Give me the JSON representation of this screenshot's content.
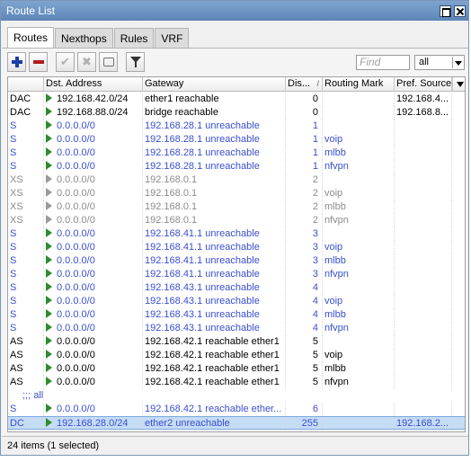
{
  "window": {
    "title": "Route List"
  },
  "tabs": [
    {
      "label": "Routes",
      "active": true
    },
    {
      "label": "Nexthops",
      "active": false
    },
    {
      "label": "Rules",
      "active": false
    },
    {
      "label": "VRF",
      "active": false
    }
  ],
  "toolbar": {
    "buttons": [
      "add-icon",
      "remove-icon",
      "enable-icon",
      "disable-icon",
      "comment-icon",
      "filter-icon"
    ],
    "find_placeholder": "Find",
    "scope_value": "all"
  },
  "columns": [
    "",
    "Dst. Address",
    "Gateway",
    "Dis...",
    "Routing Mark",
    "Pref. Source"
  ],
  "colors": {
    "unreachable": "#3a4fcf",
    "inactive": "#8c8c8c",
    "active_arrow": "#2e8b2e",
    "selected": "#c5dcf5"
  },
  "rows": [
    {
      "flags": "DAC",
      "dst": "192.168.42.0/24",
      "gateway": "ether1 reachable",
      "distance": "0",
      "mark": "",
      "pref": "192.168.4...",
      "state": "reach"
    },
    {
      "flags": "DAC",
      "dst": "192.168.88.0/24",
      "gateway": "bridge reachable",
      "distance": "0",
      "mark": "",
      "pref": "192.168.8...",
      "state": "reach"
    },
    {
      "flags": "S",
      "dst": "0.0.0.0/0",
      "gateway": "192.168.28.1 unreachable",
      "distance": "1",
      "mark": "",
      "pref": "",
      "state": "unreach"
    },
    {
      "flags": "S",
      "dst": "0.0.0.0/0",
      "gateway": "192.168.28.1 unreachable",
      "distance": "1",
      "mark": "voip",
      "pref": "",
      "state": "unreach"
    },
    {
      "flags": "S",
      "dst": "0.0.0.0/0",
      "gateway": "192.168.28.1 unreachable",
      "distance": "1",
      "mark": "mlbb",
      "pref": "",
      "state": "unreach"
    },
    {
      "flags": "S",
      "dst": "0.0.0.0/0",
      "gateway": "192.168.28.1 unreachable",
      "distance": "1",
      "mark": "nfvpn",
      "pref": "",
      "state": "unreach"
    },
    {
      "flags": "XS",
      "dst": "0.0.0.0/0",
      "gateway": "192.168.0.1",
      "distance": "2",
      "mark": "",
      "pref": "",
      "state": "inactive"
    },
    {
      "flags": "XS",
      "dst": "0.0.0.0/0",
      "gateway": "192.168.0.1",
      "distance": "2",
      "mark": "voip",
      "pref": "",
      "state": "inactive"
    },
    {
      "flags": "XS",
      "dst": "0.0.0.0/0",
      "gateway": "192.168.0.1",
      "distance": "2",
      "mark": "mlbb",
      "pref": "",
      "state": "inactive"
    },
    {
      "flags": "XS",
      "dst": "0.0.0.0/0",
      "gateway": "192.168.0.1",
      "distance": "2",
      "mark": "nfvpn",
      "pref": "",
      "state": "inactive"
    },
    {
      "flags": "S",
      "dst": "0.0.0.0/0",
      "gateway": "192.168.41.1 unreachable",
      "distance": "3",
      "mark": "",
      "pref": "",
      "state": "unreach"
    },
    {
      "flags": "S",
      "dst": "0.0.0.0/0",
      "gateway": "192.168.41.1 unreachable",
      "distance": "3",
      "mark": "voip",
      "pref": "",
      "state": "unreach"
    },
    {
      "flags": "S",
      "dst": "0.0.0.0/0",
      "gateway": "192.168.41.1 unreachable",
      "distance": "3",
      "mark": "mlbb",
      "pref": "",
      "state": "unreach"
    },
    {
      "flags": "S",
      "dst": "0.0.0.0/0",
      "gateway": "192.168.41.1 unreachable",
      "distance": "3",
      "mark": "nfvpn",
      "pref": "",
      "state": "unreach"
    },
    {
      "flags": "S",
      "dst": "0.0.0.0/0",
      "gateway": "192.168.43.1 unreachable",
      "distance": "4",
      "mark": "",
      "pref": "",
      "state": "unreach"
    },
    {
      "flags": "S",
      "dst": "0.0.0.0/0",
      "gateway": "192.168.43.1 unreachable",
      "distance": "4",
      "mark": "voip",
      "pref": "",
      "state": "unreach"
    },
    {
      "flags": "S",
      "dst": "0.0.0.0/0",
      "gateway": "192.168.43.1 unreachable",
      "distance": "4",
      "mark": "mlbb",
      "pref": "",
      "state": "unreach"
    },
    {
      "flags": "S",
      "dst": "0.0.0.0/0",
      "gateway": "192.168.43.1 unreachable",
      "distance": "4",
      "mark": "nfvpn",
      "pref": "",
      "state": "unreach"
    },
    {
      "flags": "AS",
      "dst": "0.0.0.0/0",
      "gateway": "192.168.42.1 reachable ether1",
      "distance": "5",
      "mark": "",
      "pref": "",
      "state": "reach"
    },
    {
      "flags": "AS",
      "dst": "0.0.0.0/0",
      "gateway": "192.168.42.1 reachable ether1",
      "distance": "5",
      "mark": "voip",
      "pref": "",
      "state": "reach"
    },
    {
      "flags": "AS",
      "dst": "0.0.0.0/0",
      "gateway": "192.168.42.1 reachable ether1",
      "distance": "5",
      "mark": "mlbb",
      "pref": "",
      "state": "reach"
    },
    {
      "flags": "AS",
      "dst": "0.0.0.0/0",
      "gateway": "192.168.42.1 reachable ether1",
      "distance": "5",
      "mark": "nfvpn",
      "pref": "",
      "state": "reach"
    },
    {
      "section": ";;; all"
    },
    {
      "flags": "S",
      "dst": "0.0.0.0/0",
      "gateway": "192.168.42.1 reachable ether...",
      "distance": "6",
      "mark": "",
      "pref": "",
      "state": "unreach"
    },
    {
      "flags": "DC",
      "dst": "192.168.28.0/24",
      "gateway": "ether2 unreachable",
      "distance": "255",
      "mark": "",
      "pref": "192.168.2...",
      "state": "unreach",
      "selected": true
    }
  ],
  "status": "24 items (1 selected)"
}
